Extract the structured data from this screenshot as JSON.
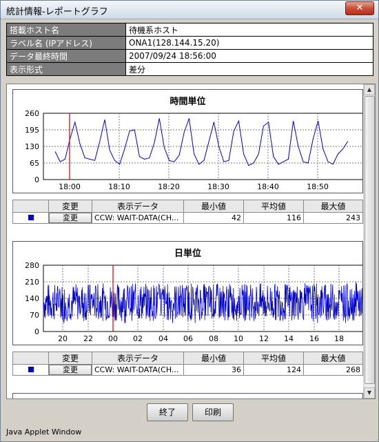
{
  "window": {
    "title": "統計情報-レポートグラフ",
    "close_label": "✕"
  },
  "info": [
    {
      "label": "搭載ホスト名",
      "value": "待機系ホスト"
    },
    {
      "label": "ラベル名 (IPアドレス)",
      "value": "ONA1(128.144.15.20)"
    },
    {
      "label": "データ最終時間",
      "value": "2007/09/24 18:56:00"
    },
    {
      "label": "表示形式",
      "value": "差分"
    }
  ],
  "colors": {
    "series": "#0000cc",
    "marker": "#cc0000"
  },
  "stats_headers": {
    "change": "変更",
    "display": "表示データ",
    "min": "最小値",
    "avg": "平均値",
    "max": "最大値"
  },
  "chart_data": [
    {
      "type": "line",
      "title": "時間単位",
      "xlabel": "",
      "ylabel": "",
      "ylim": [
        0,
        260
      ],
      "yticks": [
        "0",
        "65",
        "130",
        "195",
        "260"
      ],
      "xticks": [
        "18:00",
        "18:10",
        "18:20",
        "18:30",
        "18:40",
        "18:50"
      ],
      "grid": true,
      "marker_label": "18:00",
      "series": [
        {
          "x": [
            "17:57",
            "17:58",
            "17:59",
            "18:00",
            "18:01",
            "18:02",
            "18:03",
            "18:04",
            "18:05",
            "18:06",
            "18:07",
            "18:08",
            "18:09",
            "18:10",
            "18:11",
            "18:12",
            "18:13",
            "18:14",
            "18:15",
            "18:16",
            "18:17",
            "18:18",
            "18:19",
            "18:20",
            "18:21",
            "18:22",
            "18:23",
            "18:24",
            "18:25",
            "18:26",
            "18:27",
            "18:28",
            "18:29",
            "18:30",
            "18:31",
            "18:32",
            "18:33",
            "18:34",
            "18:35",
            "18:36",
            "18:37",
            "18:38",
            "18:39",
            "18:40",
            "18:41",
            "18:42",
            "18:43",
            "18:44",
            "18:45",
            "18:46",
            "18:47",
            "18:48",
            "18:49",
            "18:50",
            "18:51",
            "18:52",
            "18:53",
            "18:54",
            "18:55",
            "18:56"
          ],
          "values": [
            110,
            70,
            80,
            160,
            225,
            140,
            85,
            80,
            75,
            150,
            235,
            115,
            75,
            60,
            120,
            190,
            195,
            90,
            80,
            85,
            145,
            240,
            125,
            75,
            70,
            95,
            185,
            240,
            100,
            60,
            75,
            150,
            225,
            130,
            70,
            75,
            190,
            230,
            100,
            55,
            65,
            100,
            210,
            225,
            90,
            60,
            70,
            80,
            230,
            130,
            70,
            65,
            160,
            230,
            120,
            70,
            60,
            100,
            120,
            150
          ],
          "min": "42",
          "avg": "116",
          "max": "243",
          "display": "CCW: WAIT-DATA(CH...",
          "change_label": "変更"
        }
      ]
    },
    {
      "type": "line",
      "title": "日単位",
      "xlabel": "",
      "ylabel": "",
      "ylim": [
        0,
        280
      ],
      "yticks": [
        "0",
        "70",
        "140",
        "210",
        "280"
      ],
      "xticks": [
        "20",
        "22",
        "00",
        "02",
        "04",
        "06",
        "08",
        "10",
        "12",
        "14",
        "16",
        "18"
      ],
      "grid": true,
      "marker_label": "00",
      "series": [
        {
          "min": "36",
          "avg": "124",
          "max": "268",
          "display": "CCW: WAIT-DATA(CH...",
          "change_label": "変更"
        }
      ]
    }
  ],
  "buttons": {
    "close": "終了",
    "print": "印刷"
  },
  "footer": "Java Applet Window"
}
